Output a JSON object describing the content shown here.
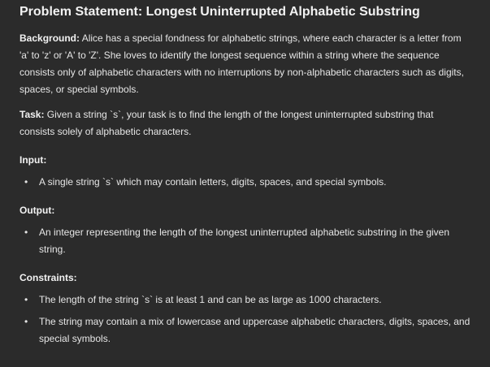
{
  "title": "Problem Statement: Longest Uninterrupted Alphabetic Substring",
  "background": {
    "label": "Background:",
    "text": " Alice has a special fondness for alphabetic strings, where each character is a letter from 'a' to 'z' or 'A' to 'Z'. She loves to identify the longest sequence within a string where the sequence consists only of alphabetic characters with no interruptions by non-alphabetic characters such as digits, spaces, or special symbols."
  },
  "task": {
    "label": "Task:",
    "text": " Given a string `s`, your task is to find the length of the longest uninterrupted substring that consists solely of alphabetic characters."
  },
  "input": {
    "heading": "Input:",
    "items": [
      "A single string `s` which may contain letters, digits, spaces, and special symbols."
    ]
  },
  "output": {
    "heading": "Output:",
    "items": [
      "An integer representing the length of the longest uninterrupted alphabetic substring in the given string."
    ]
  },
  "constraints": {
    "heading": "Constraints:",
    "items": [
      "The length of the string `s` is at least 1 and can be as large as 1000 characters.",
      "The string may contain a mix of lowercase and uppercase alphabetic characters, digits, spaces, and special symbols."
    ]
  },
  "bullet_glyph": "•"
}
